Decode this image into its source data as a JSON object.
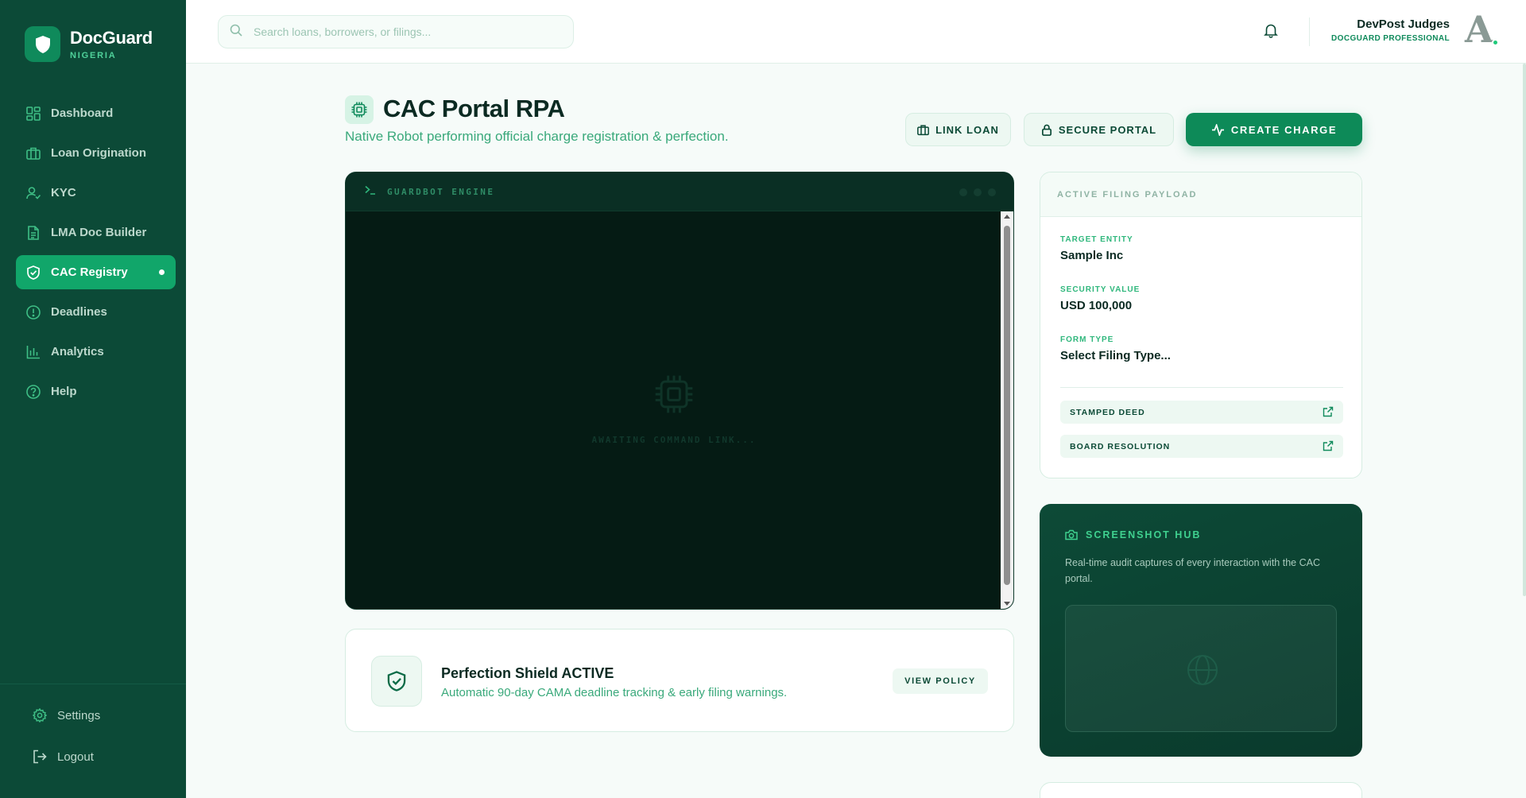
{
  "brand": {
    "name": "DocGuard",
    "subtitle": "NIGERIA"
  },
  "sidebar": {
    "items": [
      {
        "label": "Dashboard",
        "icon": "dashboard-icon"
      },
      {
        "label": "Loan Origination",
        "icon": "briefcase-icon"
      },
      {
        "label": "KYC",
        "icon": "user-check-icon"
      },
      {
        "label": "LMA Doc Builder",
        "icon": "document-icon"
      },
      {
        "label": "CAC Registry",
        "icon": "shield-check-icon",
        "active": true
      },
      {
        "label": "Deadlines",
        "icon": "alert-circle-icon"
      },
      {
        "label": "Analytics",
        "icon": "bar-chart-icon"
      },
      {
        "label": "Help",
        "icon": "help-circle-icon"
      }
    ],
    "bottom": [
      {
        "label": "Settings",
        "icon": "gear-icon"
      },
      {
        "label": "Logout",
        "icon": "logout-icon"
      }
    ]
  },
  "topbar": {
    "search_placeholder": "Search loans, borrowers, or filings...",
    "user_name": "DevPost Judges",
    "user_role": "DOCGUARD PROFESSIONAL",
    "avatar_letter": "A"
  },
  "page": {
    "title": "CAC Portal RPA",
    "subtitle": "Native Robot performing official charge registration & perfection.",
    "buttons": {
      "link_loan": "LINK LOAN",
      "secure_portal": "SECURE PORTAL",
      "create_charge": "CREATE CHARGE"
    }
  },
  "terminal": {
    "title": "GUARDBOT ENGINE",
    "status": "AWAITING COMMAND LINK..."
  },
  "payload": {
    "heading": "ACTIVE FILING PAYLOAD",
    "fields": [
      {
        "label": "TARGET ENTITY",
        "value": "Sample Inc"
      },
      {
        "label": "SECURITY VALUE",
        "value": "USD 100,000"
      },
      {
        "label": "FORM TYPE",
        "value": "Select Filing Type..."
      }
    ],
    "documents": [
      "STAMPED DEED",
      "BOARD RESOLUTION"
    ]
  },
  "shield": {
    "title": "Perfection Shield ACTIVE",
    "subtitle": "Automatic 90-day CAMA deadline tracking & early filing warnings.",
    "button": "VIEW POLICY"
  },
  "hub": {
    "title": "SCREENSHOT HUB",
    "description": "Real-time audit captures of every interaction with the CAC portal."
  },
  "colors": {
    "sidebar": "#0c4a37",
    "accent": "#0d8a58",
    "active": "#11a66a",
    "terminal": "#041c15"
  }
}
